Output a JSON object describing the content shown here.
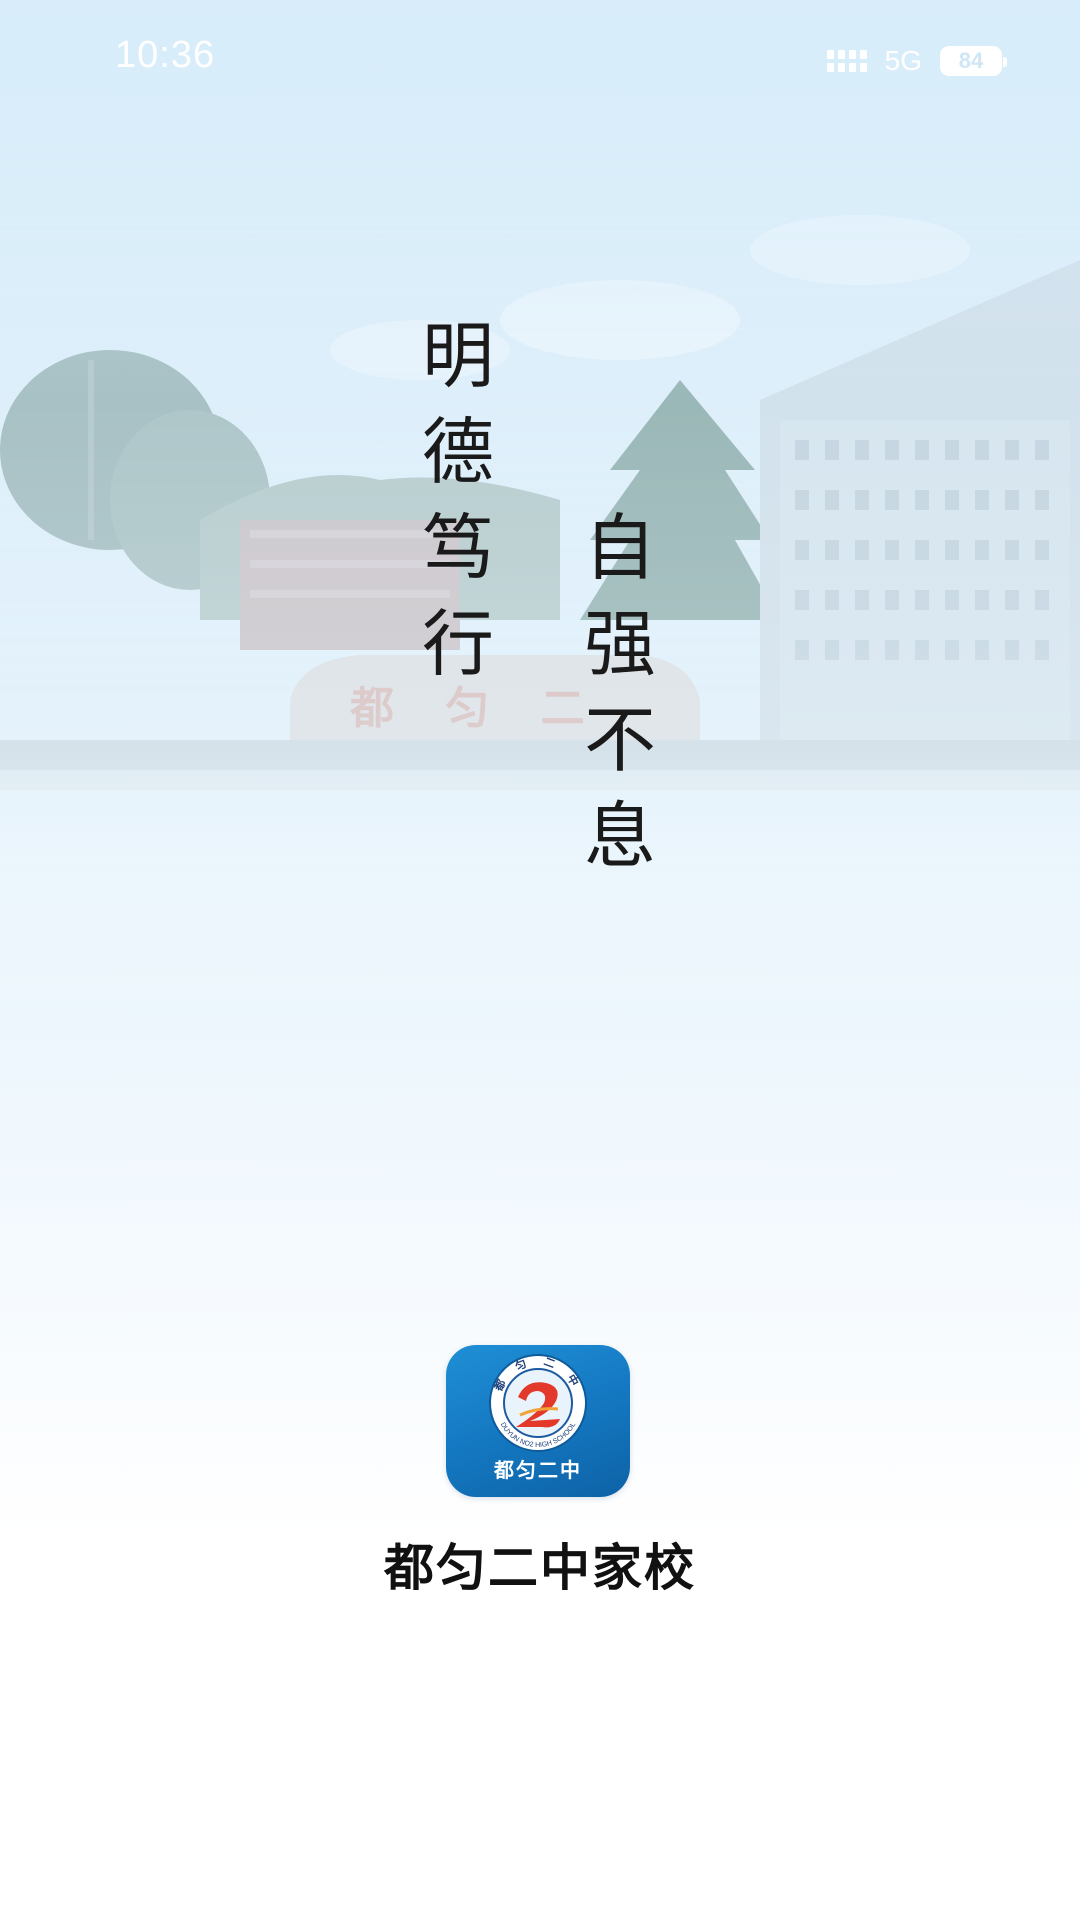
{
  "status_bar": {
    "time": "10:36",
    "network": "5G",
    "battery": "84",
    "signal_icon": "signal-bars-icon"
  },
  "motto": {
    "left_column": [
      "明",
      "德",
      "笃",
      "行"
    ],
    "right_column": [
      "自",
      "强",
      "不",
      "息"
    ]
  },
  "background": {
    "sign_text": "都 匀 二"
  },
  "app": {
    "logo_icon": "school-emblem-icon",
    "logo_top_text": "都 匀 二 中",
    "logo_ring_text": "DUYUN NO2 HIGH SCHOOL",
    "logo_bottom_text": "都匀二中",
    "name": "都匀二中家校"
  },
  "colors": {
    "sky_top": "#d6ecfa",
    "logo_blue": "#1376bf",
    "emblem_red": "#e2392b",
    "text_dark": "#111111"
  }
}
